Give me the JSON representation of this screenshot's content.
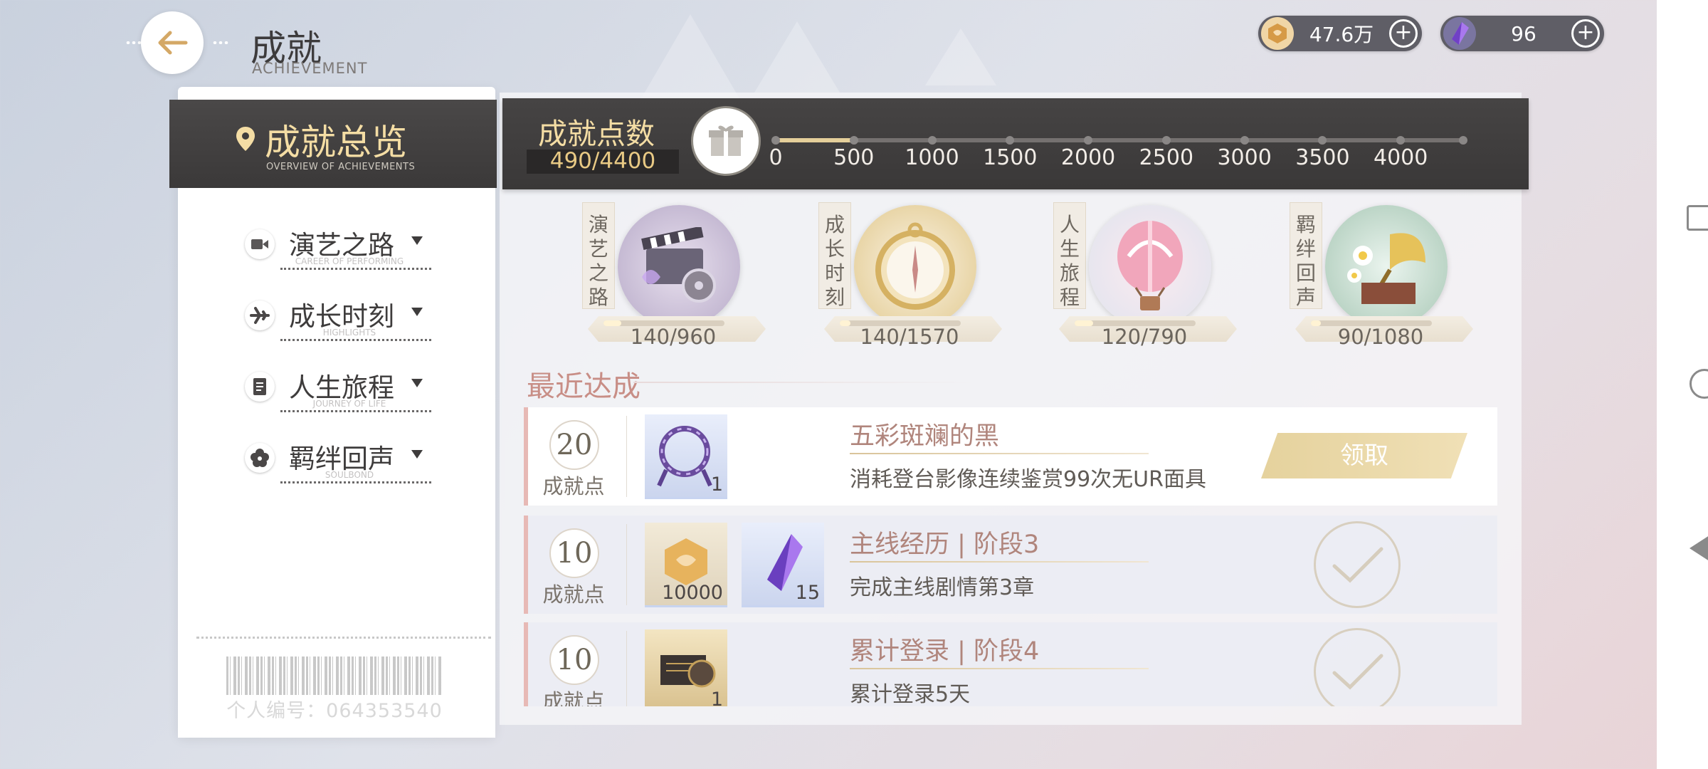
{
  "header": {
    "title": "成就",
    "subtitle": "ACHIEVEMENT",
    "back_icon": "arrow-left-icon"
  },
  "currencies": [
    {
      "icon": "gold-coin-icon",
      "value": "47.6万",
      "color": "#d6a35a"
    },
    {
      "icon": "purple-crystal-icon",
      "value": "96",
      "color": "#8a5bd6"
    }
  ],
  "sidebar": {
    "title": "成就总览",
    "subtitle": "OVERVIEW OF ACHIEVEMENTS",
    "items": [
      {
        "label": "演艺之路",
        "sub": "CAREER OF PERFORMING",
        "icon": "video-camera-icon"
      },
      {
        "label": "成长时刻",
        "sub": "HIGHLIGHTS",
        "icon": "airplane-icon"
      },
      {
        "label": "人生旅程",
        "sub": "JOURNEY OF LIFE",
        "icon": "document-icon"
      },
      {
        "label": "羁绊回声",
        "sub": "SOULBOND",
        "icon": "flower-icon"
      }
    ],
    "personal_id": "个人编号：064353540"
  },
  "points": {
    "title": "成就点数",
    "value": "490/4400",
    "current": 490,
    "max": 4400,
    "ticks": [
      "0",
      "500",
      "1000",
      "1500",
      "2000",
      "2500",
      "3000",
      "3500",
      "4000"
    ]
  },
  "categories": [
    {
      "banner": [
        "演",
        "艺",
        "之",
        "路"
      ],
      "value": "140/960",
      "progress": 0.146,
      "icon": "film-clapperboard-icon"
    },
    {
      "banner": [
        "成",
        "长",
        "时",
        "刻"
      ],
      "value": "140/1570",
      "progress": 0.089,
      "icon": "pocket-watch-icon"
    },
    {
      "banner": [
        "人",
        "生",
        "旅",
        "程"
      ],
      "value": "120/790",
      "progress": 0.152,
      "icon": "hot-air-balloon-icon"
    },
    {
      "banner": [
        "羁",
        "绊",
        "回",
        "声"
      ],
      "value": "90/1080",
      "progress": 0.083,
      "icon": "gramophone-icon"
    }
  ],
  "recent": {
    "title": "最近达成",
    "points_label": "成就点",
    "items": [
      {
        "points": "20",
        "name": "五彩斑斓的黑",
        "desc": "消耗登台影像连续鉴赏99次无UR面具",
        "rewards": [
          {
            "icon": "purple-wreath-icon",
            "qty": "1"
          }
        ],
        "status": "claim",
        "claim_label": "领取"
      },
      {
        "points": "10",
        "name": "主线经历 | 阶段3",
        "desc": "完成主线剧情第3章",
        "rewards": [
          {
            "icon": "gold-coin-icon",
            "qty": "10000"
          },
          {
            "icon": "purple-crystal-icon",
            "qty": "15"
          }
        ],
        "status": "done"
      },
      {
        "points": "10",
        "name": "累计登录 | 阶段4",
        "desc": "累计登录5天",
        "rewards": [
          {
            "icon": "film-record-icon",
            "qty": "1"
          }
        ],
        "status": "done"
      }
    ]
  }
}
